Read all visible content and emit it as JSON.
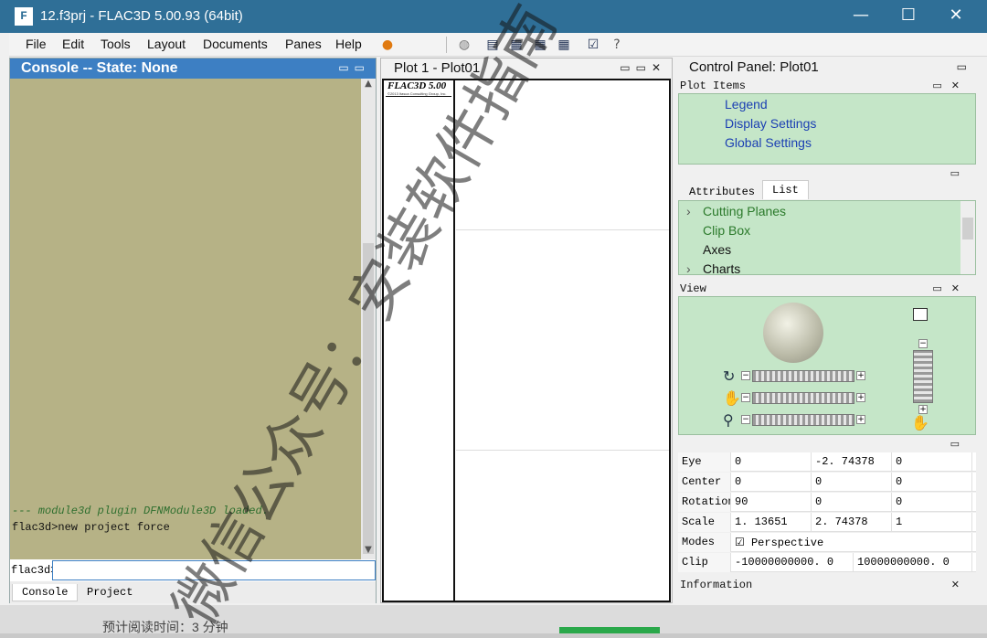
{
  "window": {
    "title": "12.f3prj - FLAC3D 5.00.93 (64bit)",
    "controls": {
      "minimize": "—",
      "maximize": "☐",
      "close": "✕"
    }
  },
  "menu": [
    "File",
    "Edit",
    "Tools",
    "Layout",
    "Documents",
    "Panes",
    "Help"
  ],
  "toolbar_icons": [
    "warning-icon",
    "globe-icon",
    "document-icon",
    "grid-icon",
    "grid-icon",
    "grid-icon",
    "checkbox-icon",
    "help-icon"
  ],
  "console": {
    "title": "Console -- State: None",
    "lines": [
      "--- module3d plugin DFNModule3D loaded.",
      "flac3d>new project force"
    ],
    "prompt": "flac3d>",
    "input_value": "",
    "tabs": [
      "Console",
      "Project"
    ]
  },
  "plot": {
    "title": "Plot 1 - Plot01",
    "legend_title": "FLAC3D 5.00",
    "legend_sub": "©2013 Itasca Consulting Group, Inc."
  },
  "control_panel": {
    "title": "Control Panel: Plot01",
    "plot_items_title": "Plot Items",
    "plot_items": [
      "Legend",
      "Display Settings",
      "Global Settings"
    ],
    "tabs": [
      "Attributes",
      "List"
    ],
    "list_items": [
      "Cutting Planes",
      "Clip Box",
      "Axes",
      "Charts"
    ],
    "view_title": "View",
    "grid": [
      {
        "label": "Eye",
        "v1": "0",
        "v2": "-2. 74378",
        "v3": "0"
      },
      {
        "label": "Center",
        "v1": "0",
        "v2": "0",
        "v3": "0"
      },
      {
        "label": "Rotation",
        "v1": "90",
        "v2": "0",
        "v3": "0"
      },
      {
        "label": "Scale",
        "v1": "1. 13651",
        "v2": "2. 74378",
        "v3": "1"
      }
    ],
    "modes_label": "Modes",
    "perspective_label": "Perspective",
    "perspective_checked": true,
    "clip_label": "Clip",
    "clip_min": "-10000000000. 0",
    "clip_max": "10000000000. 0",
    "information_title": "Information"
  },
  "watermark": "微信公众号：安装软件指南",
  "bottom_text": "预计阅读时间：3 分钟"
}
